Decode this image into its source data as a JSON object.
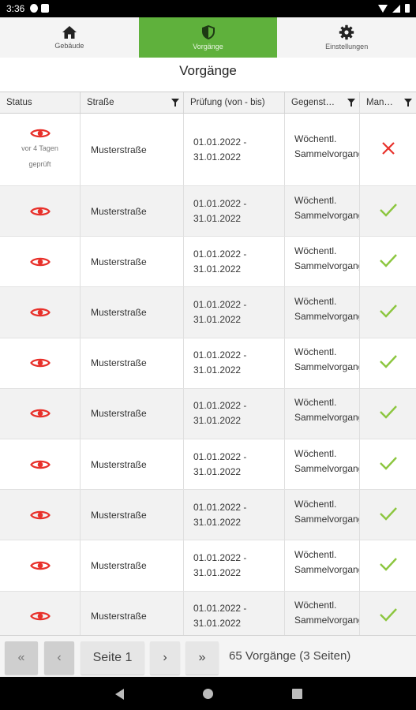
{
  "statusbar": {
    "time": "3:36"
  },
  "nav": {
    "tabs": [
      {
        "label": "Gebäude",
        "icon": "home-icon",
        "active": false
      },
      {
        "label": "Vorgänge",
        "icon": "shield-icon",
        "active": true
      },
      {
        "label": "Einstellungen",
        "icon": "gear-icon",
        "active": false
      }
    ],
    "accent": "#5fb13c"
  },
  "page_title": "Vorgänge",
  "table": {
    "columns": [
      {
        "label": "Status",
        "filter": false
      },
      {
        "label": "Straße",
        "filter": true
      },
      {
        "label": "Prüfung (von - bis)",
        "filter": false
      },
      {
        "label": "Gegenst…",
        "filter": true
      },
      {
        "label": "Man…",
        "filter": true
      }
    ],
    "rows": [
      {
        "status_icon": "eye-icon",
        "status_note_1": "vor 4 Tagen",
        "status_note_2": "geprüft",
        "street": "Musterstraße",
        "period_from": "01.01.2022 -",
        "period_to": "31.01.2022",
        "subject_1": "Wöchentl.",
        "subject_2": "Sammelvorgang",
        "mark": "cross"
      },
      {
        "status_icon": "eye-icon",
        "street": "Musterstraße",
        "period_from": "01.01.2022 -",
        "period_to": "31.01.2022",
        "subject_1": "Wöchentl.",
        "subject_2": "Sammelvorgang",
        "mark": "check"
      },
      {
        "status_icon": "eye-icon",
        "street": "Musterstraße",
        "period_from": "01.01.2022 -",
        "period_to": "31.01.2022",
        "subject_1": "Wöchentl.",
        "subject_2": "Sammelvorgang",
        "mark": "check"
      },
      {
        "status_icon": "eye-icon",
        "street": "Musterstraße",
        "period_from": "01.01.2022 -",
        "period_to": "31.01.2022",
        "subject_1": "Wöchentl.",
        "subject_2": "Sammelvorgang",
        "mark": "check"
      },
      {
        "status_icon": "eye-icon",
        "street": "Musterstraße",
        "period_from": "01.01.2022 -",
        "period_to": "31.01.2022",
        "subject_1": "Wöchentl.",
        "subject_2": "Sammelvorgang",
        "mark": "check"
      },
      {
        "status_icon": "eye-icon",
        "street": "Musterstraße",
        "period_from": "01.01.2022 -",
        "period_to": "31.01.2022",
        "subject_1": "Wöchentl.",
        "subject_2": "Sammelvorgang",
        "mark": "check"
      },
      {
        "status_icon": "eye-icon",
        "street": "Musterstraße",
        "period_from": "01.01.2022 -",
        "period_to": "31.01.2022",
        "subject_1": "Wöchentl.",
        "subject_2": "Sammelvorgang",
        "mark": "check"
      },
      {
        "status_icon": "eye-icon",
        "street": "Musterstraße",
        "period_from": "01.01.2022 -",
        "period_to": "31.01.2022",
        "subject_1": "Wöchentl.",
        "subject_2": "Sammelvorgang",
        "mark": "check"
      },
      {
        "status_icon": "eye-icon",
        "street": "Musterstraße",
        "period_from": "01.01.2022 -",
        "period_to": "31.01.2022",
        "subject_1": "Wöchentl.",
        "subject_2": "Sammelvorgang",
        "mark": "check"
      },
      {
        "status_icon": "eye-icon",
        "street": "Musterstraße",
        "period_from": "01.01.2022 -",
        "period_to": "31.01.2022",
        "subject_1": "Wöchentl.",
        "subject_2": "Sammelvorgang",
        "mark": "check"
      }
    ],
    "colors": {
      "eye": "#e8302a",
      "check": "#8cc63f",
      "cross": "#e8302a"
    }
  },
  "pagination": {
    "first": "«",
    "prev": "‹",
    "page_label": "Seite 1",
    "next": "›",
    "last": "»",
    "info": "65 Vorgänge (3 Seiten)"
  }
}
